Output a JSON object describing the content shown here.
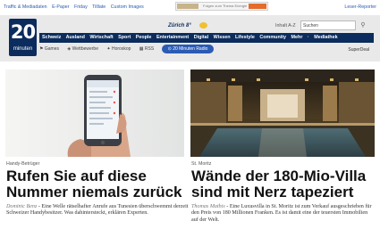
{
  "top_links": [
    "Traffic & Mediadaten",
    "E-Paper",
    "Friday",
    "Tilllate",
    "Custom Images"
  ],
  "top_ad_text": "Folgen zum Thema Energie",
  "reader_link": "Leser-Reporter",
  "logo": {
    "number": "20",
    "word": "minuten"
  },
  "weather": {
    "city": "Zürich 8°"
  },
  "az_label": "Inhalt A-Z",
  "search": {
    "value": "Suchen"
  },
  "nav_items": [
    "Schweiz",
    "Ausland",
    "Wirtschaft",
    "Sport",
    "People",
    "Entertainment",
    "Digital",
    "Wissen",
    "Lifestyle",
    "Community",
    "Mehr",
    "·",
    "Mediathek"
  ],
  "subnav_items": [
    "Games",
    "Wettbewerbe",
    "Horoskop",
    "RSS"
  ],
  "radio_label": "20 Minuten Radio",
  "superdeal_label": "SuperDeal",
  "articles": [
    {
      "kicker": "Handy-Betrüger",
      "title": "Rufen Sie auf diese Nummer niemals zurück",
      "author": "Dominic Benz",
      "teaser": " - Eine Welle rätselhafter Anrufe aus Tunesien überschwemmt derzeit Schweizer Handybesitzer. Was dahintersteckt, erklären Experten."
    },
    {
      "kicker": "St. Moritz",
      "title": "Wände der 180-Mio-Villa sind mit Nerz tapeziert",
      "author": "Thomas Mathis",
      "teaser": " - Eine Luxusvilla in St. Moritz ist zum Verkauf ausgeschrieben für den Preis von 180 Millionen Franken. Es ist damit eine der teuersten Immobilien auf der Welt."
    }
  ],
  "colors": {
    "brand": "#0b2c5c",
    "link": "#2b5bb3",
    "header_bg": "#e9e9e9"
  }
}
